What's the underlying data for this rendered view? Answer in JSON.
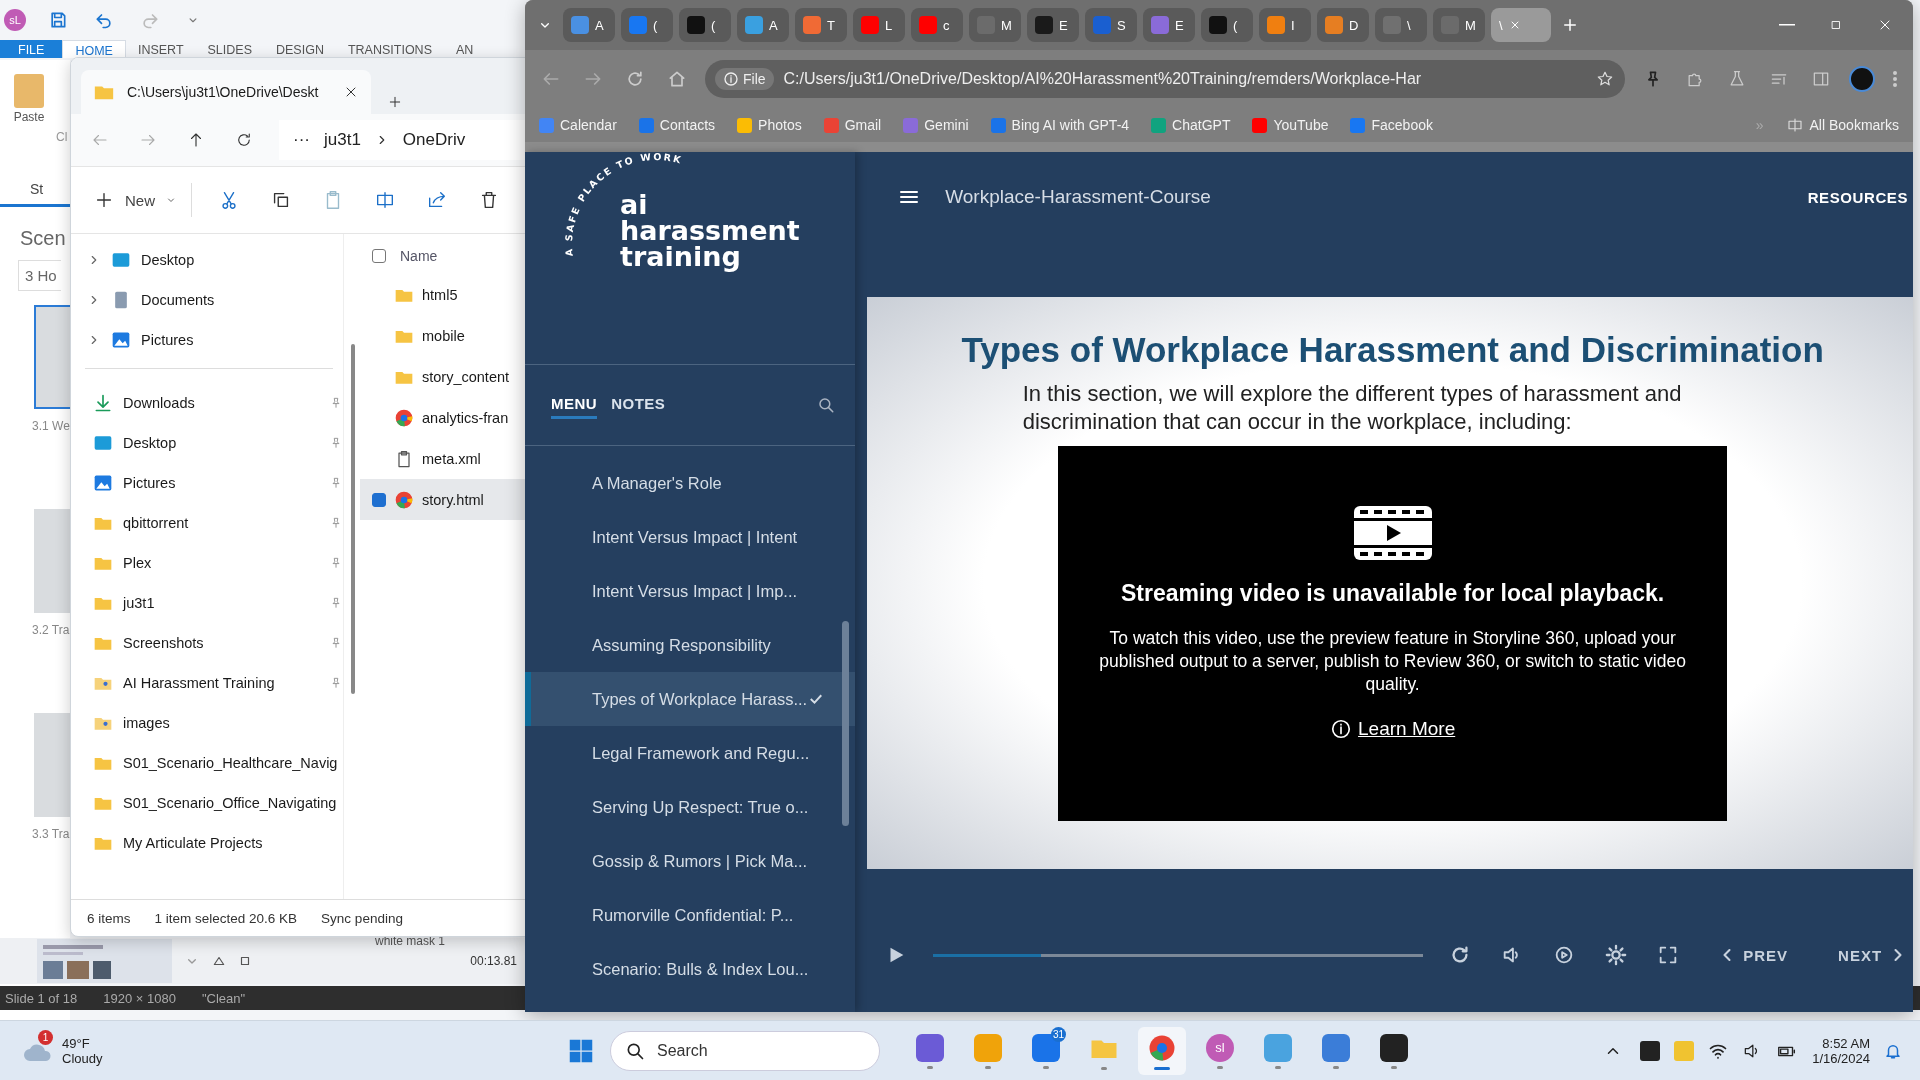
{
  "storyline": {
    "app_badge": "sL",
    "ribbon_tabs": [
      {
        "label": "FILE",
        "kind": "file",
        "selected": false
      },
      {
        "label": "HOME",
        "kind": "tab",
        "selected": true
      },
      {
        "label": "INSERT",
        "kind": "tab",
        "selected": false
      },
      {
        "label": "SLIDES",
        "kind": "tab",
        "selected": false
      },
      {
        "label": "DESIGN",
        "kind": "tab",
        "selected": false
      },
      {
        "label": "TRANSITIONS",
        "kind": "tab",
        "selected": false
      },
      {
        "label": "AN",
        "kind": "tab",
        "selected": false
      }
    ],
    "paste_label": "Paste",
    "clipboard_group": "Cl",
    "view_tab": "St",
    "panel_title": "Scen",
    "scene_field": "3 Ho",
    "slides": [
      {
        "label": "3.1 We",
        "selected": true
      },
      {
        "label": "3.2 Tra",
        "selected": false
      },
      {
        "label": "3.3 Tra",
        "selected": false
      }
    ],
    "timeline": {
      "layer": "white mask 1",
      "time": "00:13.81"
    },
    "status_bar": [
      "Slide 1 of 18",
      "1920 × 1080",
      "\"Clean\""
    ]
  },
  "explorer": {
    "tab_title": "C:\\Users\\ju3t1\\OneDrive\\Deskt",
    "breadcrumb": [
      "ju3t1",
      "OneDriv"
    ],
    "more": "···",
    "new_button": "New",
    "nav_top": [
      {
        "label": "Desktop",
        "kind": "desktop"
      },
      {
        "label": "Documents",
        "kind": "documents"
      },
      {
        "label": "Pictures",
        "kind": "pictures"
      }
    ],
    "quick_access": [
      {
        "label": "Downloads",
        "kind": "downloads",
        "pinned": true
      },
      {
        "label": "Desktop",
        "kind": "desktop",
        "pinned": true
      },
      {
        "label": "Pictures",
        "kind": "pictures",
        "pinned": true
      },
      {
        "label": "qbittorrent",
        "kind": "folder",
        "pinned": true
      },
      {
        "label": "Plex",
        "kind": "folder",
        "pinned": true
      },
      {
        "label": "ju3t1",
        "kind": "folder",
        "pinned": true
      },
      {
        "label": "Screenshots",
        "kind": "folder",
        "pinned": true
      },
      {
        "label": "AI Harassment Training",
        "kind": "shared",
        "pinned": true
      },
      {
        "label": "images",
        "kind": "shared",
        "pinned": false
      },
      {
        "label": "S01_Scenario_Healthcare_Navig",
        "kind": "folder",
        "pinned": false
      },
      {
        "label": "S01_Scenario_Office_Navigating",
        "kind": "folder",
        "pinned": false
      },
      {
        "label": "My Articulate Projects",
        "kind": "folder",
        "pinned": false
      }
    ],
    "name_column": "Name",
    "all_selected": false,
    "files": [
      {
        "name": "html5",
        "kind": "folder",
        "selected": false
      },
      {
        "name": "mobile",
        "kind": "folder",
        "selected": false
      },
      {
        "name": "story_content",
        "kind": "folder",
        "selected": false
      },
      {
        "name": "analytics-fran",
        "kind": "browser",
        "selected": false
      },
      {
        "name": "meta.xml",
        "kind": "file",
        "selected": false
      },
      {
        "name": "story.html",
        "kind": "browser",
        "selected": true
      }
    ],
    "status": [
      "6 items",
      "1 item selected  20.6 KB",
      "Sync pending"
    ]
  },
  "browser": {
    "tabs": [
      {
        "title": "A",
        "color": "#4a90e2",
        "selected": false
      },
      {
        "title": "(",
        "color": "#1877f2",
        "selected": false
      },
      {
        "title": "(",
        "color": "#111111",
        "selected": false
      },
      {
        "title": "A",
        "color": "#3aa0e0",
        "selected": false
      },
      {
        "title": "T",
        "color": "#f06a35",
        "selected": false
      },
      {
        "title": "L",
        "color": "#ff0000",
        "selected": false
      },
      {
        "title": "c",
        "color": "#ff0000",
        "selected": false
      },
      {
        "title": "M",
        "color": "#6b6b6b",
        "selected": false
      },
      {
        "title": "E",
        "color": "#1a1a1a",
        "selected": false
      },
      {
        "title": "S",
        "color": "#1a5fd0",
        "selected": false
      },
      {
        "title": "E",
        "color": "#8a6bd8",
        "selected": false
      },
      {
        "title": "(",
        "color": "#111111",
        "selected": false
      },
      {
        "title": "I",
        "color": "#f07f10",
        "selected": false
      },
      {
        "title": "D",
        "color": "#e67e22",
        "selected": false
      },
      {
        "title": "\\",
        "color": "#707070",
        "selected": false
      },
      {
        "title": "M",
        "color": "#6b6b6b",
        "selected": false
      },
      {
        "title": "\\",
        "selected": true
      }
    ],
    "address_chip": "File",
    "url": "C:/Users/ju3t1/OneDrive/Desktop/AI%20Harassment%20Training/remders/Workplace-Har",
    "bookmarks": [
      {
        "label": "Calendar",
        "color": "#4285f4"
      },
      {
        "label": "Contacts",
        "color": "#1a73e8"
      },
      {
        "label": "Photos",
        "color": "#fbbc04"
      },
      {
        "label": "Gmail",
        "color": "#ea4335"
      },
      {
        "label": "Gemini",
        "color": "#8a6bd8"
      },
      {
        "label": "Bing AI with GPT-4",
        "color": "#1a73e8"
      },
      {
        "label": "ChatGPT",
        "color": "#10a37f"
      },
      {
        "label": "YouTube",
        "color": "#ff0000"
      },
      {
        "label": "Facebook",
        "color": "#1877f2"
      }
    ],
    "overflow": "»",
    "all_bookmarks": "All Bookmarks"
  },
  "course": {
    "logo": {
      "tagline": "A SAFE PLACE TO WORK",
      "lines": [
        "ai",
        "harassment",
        "training"
      ]
    },
    "panel_tabs": [
      {
        "label": "MENU",
        "selected": true
      },
      {
        "label": "NOTES",
        "selected": false
      }
    ],
    "menu": [
      {
        "label": "A Manager's Role",
        "selected": false,
        "checked": false
      },
      {
        "label": "Intent Versus Impact | Intent",
        "selected": false,
        "checked": false
      },
      {
        "label": "Intent Versus Impact | Imp...",
        "selected": false,
        "checked": false
      },
      {
        "label": "Assuming Responsibility",
        "selected": false,
        "checked": false
      },
      {
        "label": "Types of Workplace Harass...",
        "selected": true,
        "checked": true
      },
      {
        "label": "Legal Framework and Regu...",
        "selected": false,
        "checked": false
      },
      {
        "label": "Serving Up Respect: True o...",
        "selected": false,
        "checked": false
      },
      {
        "label": "Gossip & Rumors | Pick Ma...",
        "selected": false,
        "checked": false
      },
      {
        "label": "Rumorville Confidential: P...",
        "selected": false,
        "checked": false
      },
      {
        "label": "Scenario: Bulls & Index Lou...",
        "selected": false,
        "checked": false
      }
    ],
    "title": "Workplace-Harassment-Course",
    "resources": "RESOURCES",
    "slide": {
      "title": "Types of Workplace Harassment and Discrimination",
      "intro": "In this section, we will explore the different types of harassment and discrimination that can occur in the workplace, including:",
      "video": {
        "heading": "Streaming video is unavailable for local playback.",
        "message": "To watch this video, use the preview feature in Storyline 360, upload your published output to a server, publish to Review 360, or switch to static video quality.",
        "link": "Learn More"
      }
    },
    "player": {
      "level": 0.22,
      "prev": "PREV",
      "next": "NEXT"
    }
  },
  "taskbar": {
    "weather": {
      "badge": "1",
      "temp": "49°F",
      "condition": "Cloudy"
    },
    "search": "Search",
    "apps": [
      {
        "kind": "copilot",
        "color": "#6b5bd6",
        "selected": false
      },
      {
        "kind": "mail",
        "color": "#f0a30a",
        "selected": false
      },
      {
        "kind": "calendar",
        "color": "#1a73e8",
        "badge": "31",
        "selected": false
      },
      {
        "kind": "folder",
        "color": "#f5c542",
        "selected": false
      },
      {
        "kind": "browser",
        "color": "#e94235",
        "selected": true
      },
      {
        "kind": "avatar",
        "color": "#c05bb5",
        "text": "sl",
        "selected": false
      },
      {
        "kind": "ring",
        "color": "#4aa3df",
        "selected": false
      },
      {
        "kind": "chart",
        "color": "#3b7dd8",
        "selected": false
      },
      {
        "kind": "terminal",
        "color": "#222222",
        "selected": false
      }
    ],
    "time": "8:52 AM",
    "date": "1/16/2024"
  }
}
